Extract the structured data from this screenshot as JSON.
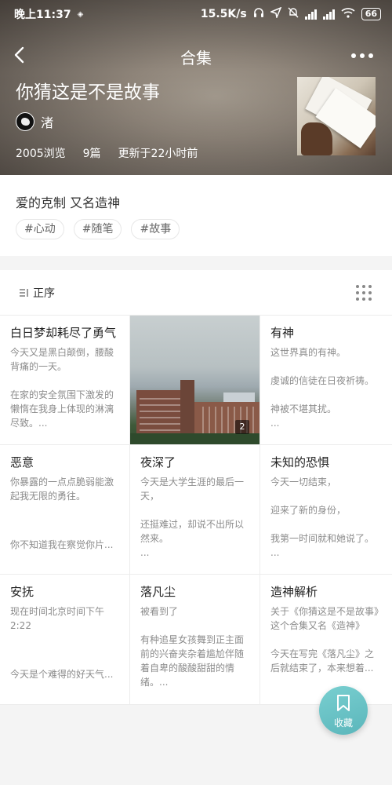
{
  "status_bar": {
    "time": "晚上11:37",
    "speed": "15.5K/s",
    "battery": "66"
  },
  "header": {
    "nav_title": "合集",
    "collection_title": "你猜这是不是故事",
    "author_name": "渚",
    "stats": {
      "views": "2005浏览",
      "count": "9篇",
      "updated": "更新于22小时前"
    }
  },
  "description": {
    "text": "爱的克制 又名造神",
    "tags": [
      "#心动",
      "#随笔",
      "#故事"
    ]
  },
  "sort": {
    "label": "正序"
  },
  "articles": [
    {
      "title": "白日梦却耗尽了勇气",
      "p1": "今天又是黑白颠倒，腰酸背痛的一天。",
      "p2": "在家的安全氛围下激发的懒惰在我身上体现的淋漓尽致。..."
    },
    {
      "title": "",
      "photo": true,
      "count": "2"
    },
    {
      "title": "有神",
      "p1": "这世界真的有神。",
      "p2": "虔诚的信徒在日夜祈祷。",
      "p3": "神被不堪其扰。",
      "p4": "..."
    },
    {
      "title": "恶意",
      "p1": "你暴露的一点点脆弱能激起我无限的勇往。",
      "p2": "你不知道我在察觉你片..."
    },
    {
      "title": "夜深了",
      "p1": "今天是大学生涯的最后一天，",
      "p2": "还挺难过，却说不出所以然来。",
      "p3": "..."
    },
    {
      "title": "未知的恐惧",
      "p1": "今天一切结束，",
      "p2": "迎来了新的身份，",
      "p3": "我第一时间就和她说了。",
      "p4": "..."
    },
    {
      "title": "安抚",
      "p1": "现在时间北京时间下午2:22",
      "p2": "今天是个难得的好天气..."
    },
    {
      "title": "落凡尘",
      "p1": "被看到了",
      "p2": "有种追星女孩舞到正主面前的兴奋夹杂着尴尬伴随着自卑的酸酸甜甜的情绪。..."
    },
    {
      "title": "造神解析",
      "p1": "关于《你猜这是不是故事》这个合集又名《造神》",
      "p2": "今天在写完《落凡尘》之后就结束了，本来想着..."
    }
  ],
  "fab": {
    "label": "收藏"
  }
}
